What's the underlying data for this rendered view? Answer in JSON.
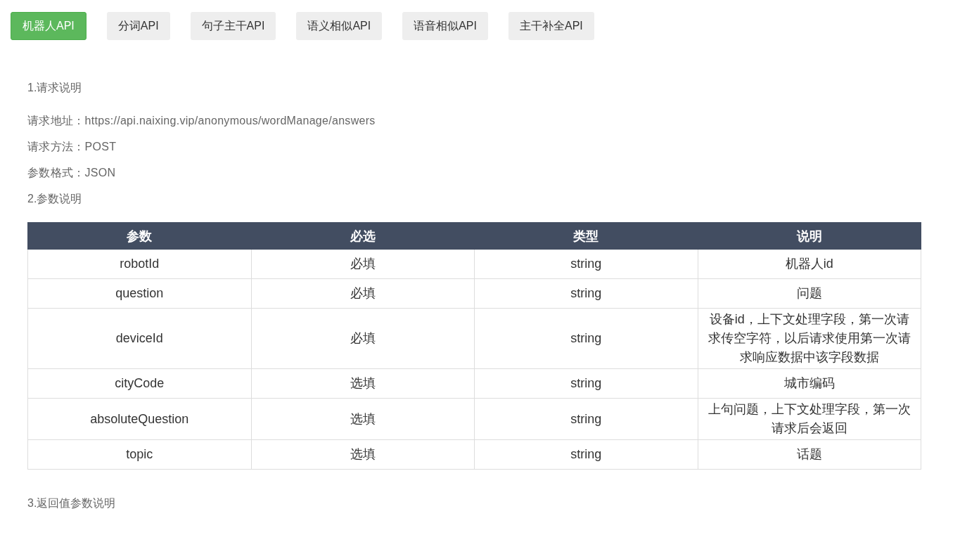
{
  "tabs": [
    {
      "label": "机器人API",
      "selected": true
    },
    {
      "label": "分词API",
      "selected": false
    },
    {
      "label": "句子主干API",
      "selected": false
    },
    {
      "label": "语义相似API",
      "selected": false
    },
    {
      "label": "语音相似API",
      "selected": false
    },
    {
      "label": "主干补全API",
      "selected": false
    }
  ],
  "request_heading": "1.请求说明",
  "request_info": [
    {
      "label": "请求地址：",
      "value": "https://api.naixing.vip/anonymous/wordManage/answers"
    },
    {
      "label": "请求方法：",
      "value": "POST"
    },
    {
      "label": "参数格式：",
      "value": "JSON"
    }
  ],
  "params_heading": "2.参数说明",
  "table": {
    "columns": [
      "参数",
      "必选",
      "类型",
      "说明"
    ],
    "rows": [
      [
        "robotId",
        "必填",
        "string",
        "机器人id"
      ],
      [
        "question",
        "必填",
        "string",
        "问题"
      ],
      [
        "deviceId",
        "必填",
        "string",
        "设备id，上下文处理字段，第一次请求传空字符，以后请求使用第一次请求响应数据中该字段数据"
      ],
      [
        "cityCode",
        "选填",
        "string",
        "城市编码"
      ],
      [
        "absoluteQuestion",
        "选填",
        "string",
        "上句问题，上下文处理字段，第一次请求后会返回"
      ],
      [
        "topic",
        "选填",
        "string",
        "话题"
      ]
    ]
  },
  "return_heading": "3.返回值参数说明"
}
